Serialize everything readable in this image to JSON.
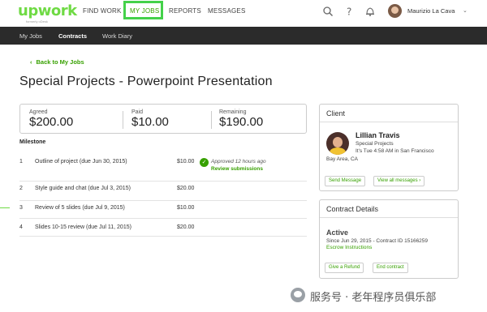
{
  "brand": {
    "logo_text": "upwork",
    "logo_tagline": "formerly oDesk"
  },
  "nav": {
    "find_work": "FIND WORK",
    "my_jobs": "MY JOBS",
    "reports": "REPORTS",
    "messages": "MESSAGES",
    "user_name": "Maurizio La Cava"
  },
  "subnav": {
    "my_jobs": "My Jobs",
    "contracts": "Contracts",
    "work_diary": "Work Diary"
  },
  "back_link": "Back to My Jobs",
  "page_title": "Special Projects - Powerpoint Presentation",
  "summary": {
    "agreed_label": "Agreed",
    "agreed_value": "$200.00",
    "paid_label": "Paid",
    "paid_value": "$10.00",
    "remaining_label": "Remaining",
    "remaining_value": "$190.00"
  },
  "milestone": {
    "heading": "Milestone",
    "rows": [
      {
        "num": "1",
        "desc": "Outline of project (due Jun 30, 2015)",
        "amount": "$10.00"
      },
      {
        "num": "2",
        "desc": "Style guide and chat (due Jul 3, 2015)",
        "amount": "$20.00"
      },
      {
        "num": "3",
        "desc": "Review of 5 slides (due Jul 9, 2015)",
        "amount": "$10.00"
      },
      {
        "num": "4",
        "desc": "Slides 10-15 review (due Jul 11, 2015)",
        "amount": "$20.00"
      }
    ],
    "approved_text": "Approved 12 hours ago",
    "review_link": "Review submissions"
  },
  "client": {
    "header": "Client",
    "name": "Lillian Travis",
    "project": "Special Projects",
    "local_time": "It's Tue 4:58 AM in San Francisco",
    "location": "Bay Area, CA",
    "send_message": "Send Message",
    "view_all": "View all messages ›"
  },
  "contract": {
    "header": "Contract Details",
    "status": "Active",
    "since": "Since Jun 29, 2015 - Contract ID 15166259",
    "escrow": "Escrow Instructions",
    "give_refund": "Give a Refund",
    "end_contract": "End contract"
  },
  "watermark": {
    "text": "服务号 · 老年程序员俱乐部"
  },
  "colors": {
    "brand_green": "#6fda44",
    "link_green": "#37a000",
    "subnav_bg": "#2b2b2b",
    "highlight": "#44d14a"
  }
}
